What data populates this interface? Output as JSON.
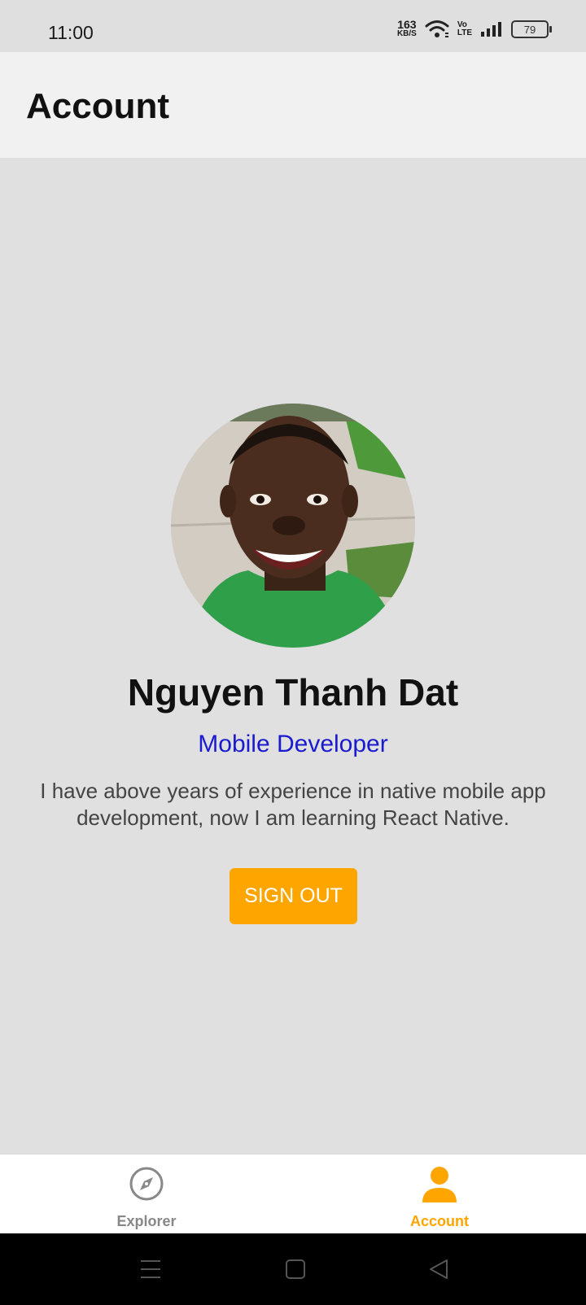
{
  "status_bar": {
    "time": "11:00",
    "net_speed_value": "163",
    "net_speed_unit": "KB/S",
    "volte_top": "Vo",
    "volte_bottom": "LTE",
    "battery": "79"
  },
  "header": {
    "title": "Account"
  },
  "profile": {
    "name": "Nguyen Thanh Dat",
    "role": "Mobile Developer",
    "bio": "I have above years of experience in native mobile app development, now I am learning React Native.",
    "sign_out_label": "SIGN OUT"
  },
  "tabs": [
    {
      "label": "Explorer",
      "icon": "compass-icon",
      "active": false
    },
    {
      "label": "Account",
      "icon": "person-icon",
      "active": true
    }
  ],
  "colors": {
    "accent": "#ffa500",
    "role_text": "#1a1acf",
    "background": "#e0e0e0"
  },
  "icons": {
    "nav_menu": "menu-icon",
    "nav_home": "home-square-icon",
    "nav_back": "back-triangle-icon"
  }
}
